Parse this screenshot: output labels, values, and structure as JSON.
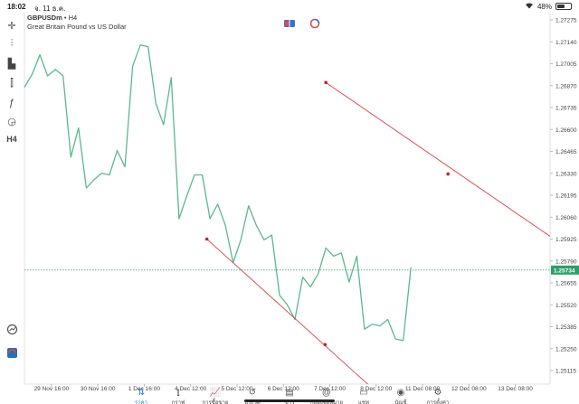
{
  "status_bar": {
    "time": "18:02",
    "date": "จ. 11 ธ.ค.",
    "battery": "48%",
    "battery_level": 0.48
  },
  "chart_header": {
    "symbol": "GBPUSDm",
    "separator": "•",
    "timeframe": "H4",
    "description": "Great Britain Pound vs US Dollar"
  },
  "left_toolbar": [
    {
      "name": "crosshair-icon",
      "glyph": "✛"
    },
    {
      "name": "indicators-icon",
      "glyph": "⫶"
    },
    {
      "name": "volume-icon",
      "glyph": "▙"
    },
    {
      "name": "settings-sliders-icon",
      "glyph": "⫿"
    },
    {
      "name": "function-icon",
      "glyph": "ƒ"
    },
    {
      "name": "objects-icon",
      "glyph": "◶"
    },
    {
      "name": "timeframe-button",
      "glyph": "H4"
    }
  ],
  "chart_data": {
    "type": "line",
    "series_color": "#5bb98f",
    "current_price": "1.25734",
    "current_price_value": 1.25734,
    "y_ticks": [
      "1.27275",
      "1.27140",
      "1.27005",
      "1.26870",
      "1.26735",
      "1.26600",
      "1.26465",
      "1.26330",
      "1.26195",
      "1.26060",
      "1.25925",
      "1.25790",
      "1.25655",
      "1.25520",
      "1.25385",
      "1.25250",
      "1.25115"
    ],
    "ylim": [
      1.2505,
      1.2734
    ],
    "x_labels": [
      "29 Nov 16:00",
      "30 Nov 16:00",
      "1 Dec 16:00",
      "4 Dec 12:00",
      "5 Dec 12:00",
      "6 Dec 12:00",
      "7 Dec 12:00",
      "8 Dec 12:00",
      "11 Dec 08:00",
      "12 Dec 08:00",
      "13 Dec 08:00"
    ],
    "x_label_index": [
      3.5,
      9.5,
      15.5,
      21.5,
      27.5,
      33.5,
      39.5,
      45.5,
      51.5,
      57.5,
      63.5
    ],
    "x_max": 68,
    "values": [
      1.2686,
      1.2694,
      1.2706,
      1.2693,
      1.2697,
      1.2693,
      1.2643,
      1.2661,
      1.2624,
      1.2629,
      1.2633,
      1.2632,
      1.2647,
      1.2637,
      1.2699,
      1.2712,
      1.2711,
      1.2676,
      1.2663,
      1.2692,
      1.2605,
      1.2619,
      1.2632,
      1.2632,
      1.2605,
      1.2614,
      1.2601,
      1.2578,
      1.2592,
      1.2613,
      1.2601,
      1.2592,
      1.2595,
      1.2558,
      1.2552,
      1.2543,
      1.2569,
      1.2563,
      1.2571,
      1.2587,
      1.2582,
      1.2584,
      1.2566,
      1.2582,
      1.2537,
      1.254,
      1.2539,
      1.2543,
      1.2531,
      1.253,
      1.2575
    ],
    "trend_lines": [
      {
        "color": "#e04040",
        "points": [
          [
            23.6,
            1.25925
          ],
          [
            38.9,
            1.25275
          ],
          [
            49.1,
            1.2483
          ]
        ]
      },
      {
        "color": "#e04040",
        "points": [
          [
            39.0,
            1.26889
          ],
          [
            54.8,
            1.26326
          ],
          [
            68.0,
            1.25942
          ]
        ]
      }
    ]
  },
  "bottom_nav": [
    {
      "name": "nav-quotes",
      "icon": "sort-arrows-icon",
      "glyph": "⇅",
      "label": "ราคา",
      "active": true
    },
    {
      "name": "nav-chart",
      "icon": "candlestick-icon",
      "glyph": "⫾",
      "label": "กราฟ",
      "active": false
    },
    {
      "name": "nav-trade",
      "icon": "trend-chart-icon",
      "glyph": "📈",
      "label": "การซื้อขาย",
      "active": false
    },
    {
      "name": "nav-history",
      "icon": "history-icon",
      "glyph": "↺",
      "label": "ประวัติ",
      "active": false
    },
    {
      "name": "nav-news",
      "icon": "news-icon",
      "glyph": "▤",
      "label": "ข่าว",
      "active": false
    },
    {
      "name": "nav-mailbox",
      "icon": "at-icon",
      "glyph": "@",
      "label": "กล่องจดหมาย",
      "active": false
    },
    {
      "name": "nav-chat",
      "icon": "chat-icon",
      "glyph": "▭",
      "label": "แชท",
      "active": false
    },
    {
      "name": "nav-accounts",
      "icon": "account-icon",
      "glyph": "◉",
      "label": "บัญชี",
      "active": false
    },
    {
      "name": "nav-settings",
      "icon": "gear-icon",
      "glyph": "⚙",
      "label": "การตั้งค่า",
      "active": false
    }
  ]
}
